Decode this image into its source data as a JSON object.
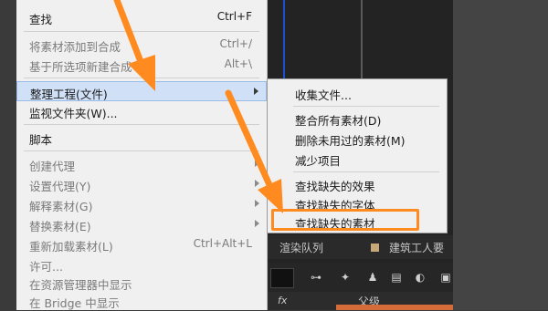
{
  "colors": {
    "accent_orange": "#ff8a1f",
    "highlight_blue": "#cfe0f7",
    "menu_bg": "#f0f0f0"
  },
  "main_menu": {
    "items": [
      {
        "label": "查找",
        "shortcut": "Ctrl+F",
        "enabled": true
      },
      {
        "label": "将素材添加到合成",
        "shortcut": "Ctrl+/",
        "enabled": false
      },
      {
        "label": "基于所选项新建合成",
        "shortcut": "Alt+\\",
        "enabled": false
      },
      {
        "label": "整理工程(文件)",
        "shortcut": "",
        "enabled": true,
        "submenu": true,
        "highlighted": true
      },
      {
        "label": "监视文件夹(W)...",
        "shortcut": "",
        "enabled": true
      },
      {
        "label": "脚本",
        "shortcut": "",
        "enabled": true
      },
      {
        "label": "创建代理",
        "shortcut": "",
        "enabled": false,
        "submenu": true
      },
      {
        "label": "设置代理(Y)",
        "shortcut": "",
        "enabled": false,
        "submenu": true
      },
      {
        "label": "解释素材(G)",
        "shortcut": "",
        "enabled": false,
        "submenu": true
      },
      {
        "label": "替换素材(E)",
        "shortcut": "",
        "enabled": false,
        "submenu": true
      },
      {
        "label": "重新加载素材(L)",
        "shortcut": "Ctrl+Alt+L",
        "enabled": false
      },
      {
        "label": "许可...",
        "shortcut": "",
        "enabled": false
      },
      {
        "label": "在资源管理器中显示",
        "shortcut": "",
        "enabled": false
      },
      {
        "label": "在 Bridge 中显示",
        "shortcut": "",
        "enabled": false
      }
    ]
  },
  "sub_menu": {
    "items": [
      {
        "label": "收集文件..."
      },
      {
        "label": "整合所有素材(D)"
      },
      {
        "label": "删除未用过的素材(M)"
      },
      {
        "label": "减少项目"
      },
      {
        "label": "查找缺失的效果"
      },
      {
        "label": "查找缺失的字体"
      },
      {
        "label": "查找缺失的素材",
        "highlighted": true
      }
    ]
  },
  "panel": {
    "tab_render_queue": "渲染队列",
    "tab_comp": "建筑工人要",
    "fx_label": "fx",
    "parent_label": "父级"
  }
}
